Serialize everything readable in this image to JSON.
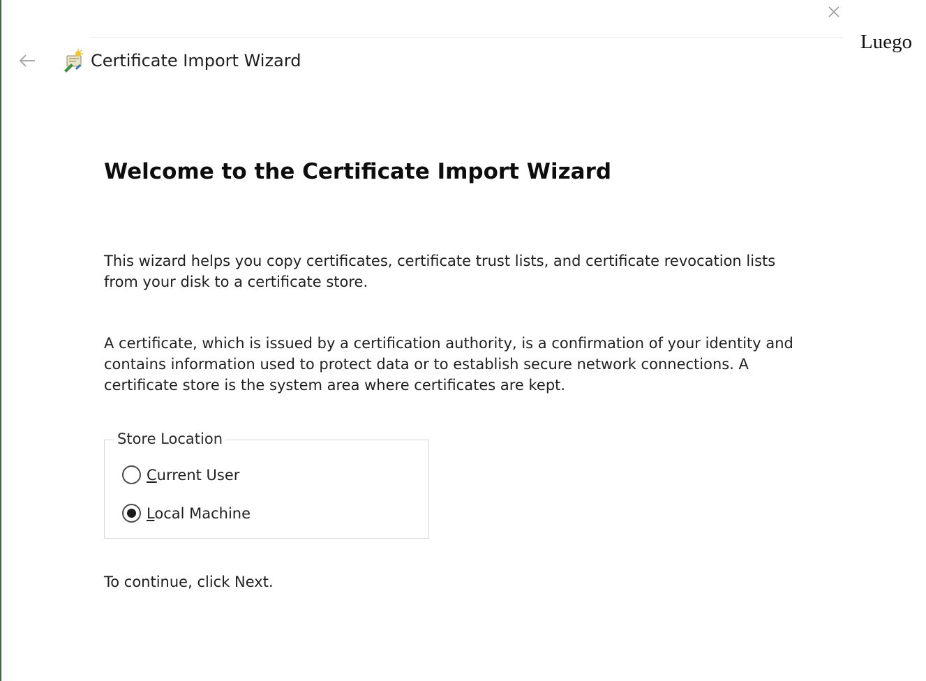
{
  "window": {
    "title": "Certificate Import Wizard",
    "side_text": "Luego"
  },
  "icons": {
    "close": "close-icon",
    "back": "back-arrow-icon",
    "wizard": "certificate-wizard-icon"
  },
  "content": {
    "heading": "Welcome to the Certificate Import Wizard",
    "paragraph1": "This wizard helps you copy certificates, certificate trust lists, and certificate revocation lists from your disk to a certificate store.",
    "paragraph2": "A certificate, which is issued by a certification authority, is a confirmation of your identity and contains information used to protect data or to establish secure network connections. A certificate store is the system area where certificates are kept.",
    "store_location": {
      "legend": "Store Location",
      "options": [
        {
          "label": "Current User",
          "accel": "C",
          "rest": "urrent User",
          "selected": false
        },
        {
          "label": "Local Machine",
          "accel": "L",
          "rest": "ocal Machine",
          "selected": true
        }
      ]
    },
    "continue_text": "To continue, click Next."
  },
  "colors": {
    "left_border": "#3a6e3a",
    "background": "#ffffff",
    "text": "#1f1f1f"
  }
}
